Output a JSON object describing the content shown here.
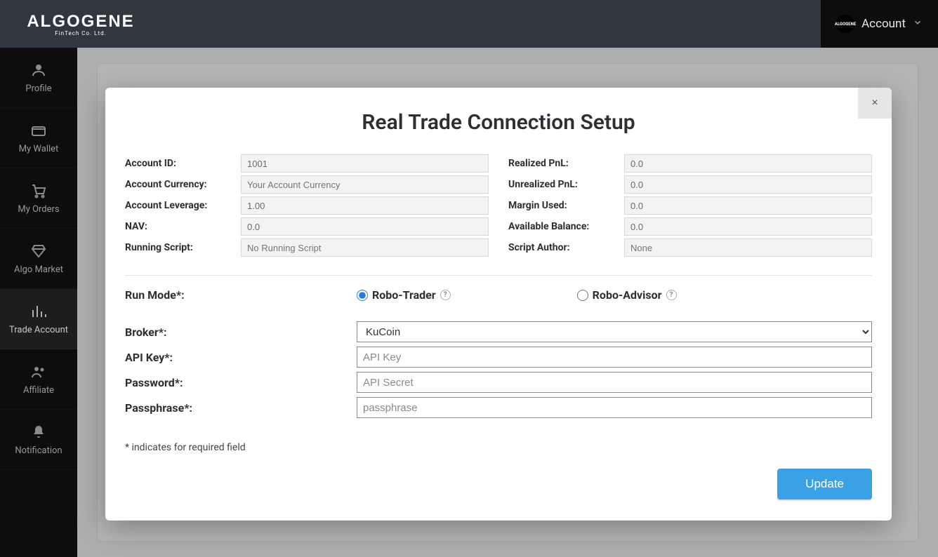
{
  "brand": {
    "name": "ALGOGENE",
    "sub": "FinTech Co. Ltd."
  },
  "account_menu": {
    "label": "Account"
  },
  "sidebar": {
    "items": [
      {
        "label": "Profile"
      },
      {
        "label": "My Wallet"
      },
      {
        "label": "My Orders"
      },
      {
        "label": "Algo Market"
      },
      {
        "label": "Trade Account"
      },
      {
        "label": "Affiliate"
      },
      {
        "label": "Notification"
      }
    ]
  },
  "modal": {
    "title": "Real Trade Connection Setup",
    "close": "×",
    "left_fields": [
      {
        "label": "Account ID:",
        "value": "1001"
      },
      {
        "label": "Account Currency:",
        "value": "",
        "placeholder": "Your Account Currency"
      },
      {
        "label": "Account Leverage:",
        "value": "1.00"
      },
      {
        "label": "NAV:",
        "value": "0.0"
      },
      {
        "label": "Running Script:",
        "value": "",
        "placeholder": "No Running Script"
      }
    ],
    "right_fields": [
      {
        "label": "Realized PnL:",
        "value": "0.0"
      },
      {
        "label": "Unrealized PnL:",
        "value": "0.0"
      },
      {
        "label": "Margin Used:",
        "value": "0.0"
      },
      {
        "label": "Available Balance:",
        "value": "0.0"
      },
      {
        "label": "Script Author:",
        "value": "",
        "placeholder": "None"
      }
    ],
    "run_mode": {
      "label": "Run Mode*:",
      "options": [
        {
          "label": "Robo-Trader",
          "checked": true
        },
        {
          "label": "Robo-Advisor",
          "checked": false
        }
      ]
    },
    "broker": {
      "label": "Broker*:",
      "selected": "KuCoin"
    },
    "api_key": {
      "label": "API Key*:",
      "placeholder": "API Key"
    },
    "password": {
      "label": "Password*:",
      "placeholder": "API Secret"
    },
    "passphrase": {
      "label": "Passphrase*:",
      "placeholder": "passphrase"
    },
    "required_note": "* indicates for required field",
    "update_btn": "Update"
  }
}
